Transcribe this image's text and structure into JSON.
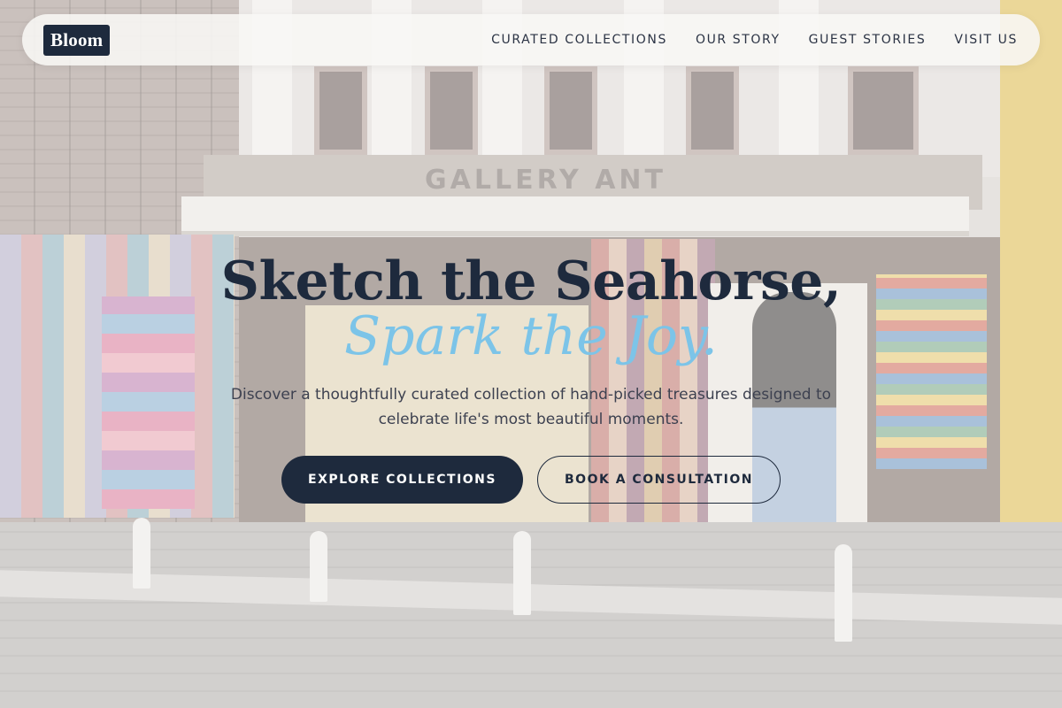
{
  "brand": {
    "logo_text": "Bloom"
  },
  "nav": {
    "links": [
      "CURATED COLLECTIONS",
      "OUR STORY",
      "GUEST STORIES",
      "VISIT US"
    ]
  },
  "hero": {
    "title_line1": "Sketch the Seahorse,",
    "title_line2": "Spark the Joy.",
    "subtitle": "Discover a thoughtfully curated collection of hand-picked treasures designed to celebrate life's most beautiful moments.",
    "primary_cta": "EXPLORE COLLECTIONS",
    "secondary_cta": "BOOK A CONSULTATION"
  },
  "background": {
    "storefront_sign": "GALLERY ANT"
  },
  "colors": {
    "navy": "#1e2a3d",
    "accent_blue": "#7cc4e8",
    "nav_background": "#f8f7f5"
  }
}
